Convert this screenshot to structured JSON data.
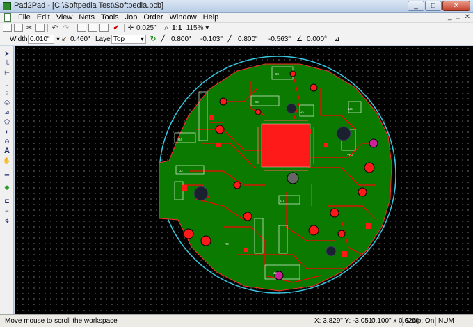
{
  "window": {
    "title": "Pad2Pad - [C:\\Softpedia Test\\Softpedia.pcb]",
    "buttons": {
      "minimize": "_",
      "maximize": "□",
      "close": "✕"
    }
  },
  "menu": {
    "items": [
      "File",
      "Edit",
      "View",
      "Nets",
      "Tools",
      "Job",
      "Order",
      "Window",
      "Help"
    ],
    "mdi": [
      "_",
      "□",
      "✕"
    ]
  },
  "toolbar1": {
    "grid_value": "0.025\"",
    "zoom_one": "1:1",
    "zoom_value": "115%"
  },
  "toolbar2": {
    "width_label": "Width:",
    "width_value": "0.010\"",
    "clearance_value": "0.460\"",
    "layer_label": "Layer:",
    "layer_value": "Top",
    "x1": "0.800\"",
    "y1": "-0.103\"",
    "x2": "0.800\"",
    "y2": "-0.563\"",
    "angle": "0.000°"
  },
  "board": {
    "labels": [
      "U4",
      "U2",
      "C9",
      "C3",
      "Q1",
      "R9",
      "U7",
      "VR3",
      "J2",
      "U5"
    ]
  },
  "status": {
    "message": "Move mouse to scroll the workspace",
    "coords": "X: 3.829\" Y: -3.051\"",
    "grid": "0.100\" x 0.025\"",
    "snap": "Snap: On",
    "num": "NUM"
  },
  "colors": {
    "board_green": "#0a7a00",
    "trace_red": "#ff0000",
    "outline_cyan": "#39c6e0",
    "chip_red": "#ff1a1a"
  }
}
